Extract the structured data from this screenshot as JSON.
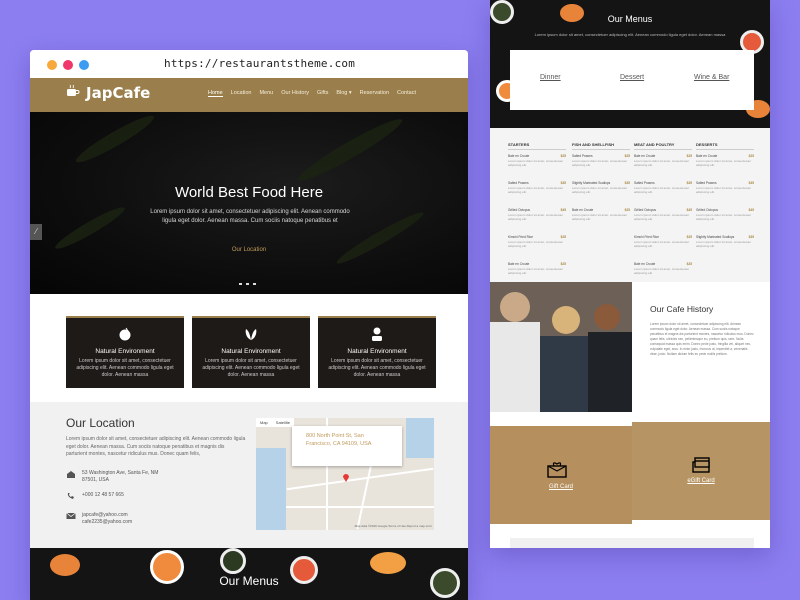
{
  "browser": {
    "url": "https://restaurantstheme.com"
  },
  "site": {
    "logo": "JapCafe",
    "nav": [
      "Home",
      "Location",
      "Menu",
      "Our History",
      "Gifts",
      "Blog ▾",
      "Reservation",
      "Contact"
    ]
  },
  "hero": {
    "title": "World Best Food Here",
    "subtitle": "Lorem ipsum dolor sit amet, consectetuer adipiscing elit. Aenean commodo ligula eget dolor. Aenean massa. Cum sociis natoque penatibus et",
    "link": "Our Location"
  },
  "features": [
    {
      "title": "Natural Environment",
      "text": "Lorem ipsum dolor sit amet, consectetuer adipiscing elit. Aenean commodo ligula eget dolor. Aenean massa"
    },
    {
      "title": "Natural Environment",
      "text": "Lorem ipsum dolor sit amet, consectetuer adipiscing elit. Aenean commodo ligula eget dolor. Aenean massa"
    },
    {
      "title": "Natural Environment",
      "text": "Lorem ipsum dolor sit amet, consectetuer adipiscing elit. Aenean commodo ligula eget dolor. Aenean massa"
    }
  ],
  "location": {
    "title": "Our Location",
    "desc": "Lorem ipsum dolor sit amet, consectetuer adipiscing elit. Aenean commodo ligula eget dolor. Aenean massa. Cum sociis natoque penatibus et magnis dis parturient montes, nascetur ridiculus mus. Donec quam felis,",
    "address": "53 Washington Ave, Santa Fe, NM 87501, USA",
    "phone": "+000 12 48 57 665",
    "email": "japcafe@yahoo.com\ncafe2235@yahoo.com",
    "map_tabs": [
      "Map",
      "Satellite"
    ],
    "map_popup": "800 North Point St, San Francisco, CA 94109, USA",
    "map_footer": "Map data ©2016 Google   Terms of Use   Report a map error"
  },
  "menus_strip": {
    "title": "Our Menus"
  },
  "right": {
    "menus_title": "Our Menus",
    "menus_sub": "Lorem ipsum dolor sit amet, consectetuer adipiscing elit. Aenean commodo ligula eget dolor. Aenean massa",
    "tabs": [
      "Dinner",
      "Dessert",
      "Wine & Bar"
    ],
    "columns": [
      {
        "head": "STARTERS",
        "items": [
          {
            "name": "Bale en Croute",
            "price": "$25"
          },
          {
            "name": "Salted Prawns",
            "price": "$35"
          },
          {
            "name": "Grilled Octopus",
            "price": "$45"
          },
          {
            "name": "Kimchi Fried Rice",
            "price": "$25"
          },
          {
            "name": "Bale en Croute",
            "price": "$25"
          }
        ]
      },
      {
        "head": "FISH AND SHELLFISH",
        "items": [
          {
            "name": "Salted Prawns",
            "price": "$25"
          },
          {
            "name": "Slightly Marinated Scallops",
            "price": "$35"
          },
          {
            "name": "Bale en Croute",
            "price": "$25"
          }
        ]
      },
      {
        "head": "MEAT AND POULTRY",
        "items": [
          {
            "name": "Bale en Croute",
            "price": "$25"
          },
          {
            "name": "Salted Prawns",
            "price": "$35"
          },
          {
            "name": "Grilled Octopus",
            "price": "$45"
          },
          {
            "name": "Kimchi Fried Rice",
            "price": "$25"
          },
          {
            "name": "Bale en Croute",
            "price": "$25"
          }
        ]
      },
      {
        "head": "DESSERTS",
        "items": [
          {
            "name": "Bale en Croute",
            "price": "$25"
          },
          {
            "name": "Salted Prawns",
            "price": "$35"
          },
          {
            "name": "Grilled Octopus",
            "price": "$45"
          },
          {
            "name": "Slightly Marinated Scallops",
            "price": "$35"
          }
        ]
      }
    ],
    "item_desc": "Lorem ipsum dolor sit amet, consectetuer adipiscing elit.",
    "history_title": "Our Cafe History",
    "history_text": "Lorem ipsum dolor sit amet, consectetuer adipiscing elit. Aenean commodo ligula eget dolor. Aenean massa. Cum sociis natoque penatibus et magnis dis parturient montes, nascetur ridiculus mus. Donec quam felis, ultricies nec, pellentesque eu, pretium quis, sem. Nulla consequat massa quis enim. Donec pede justo, fringilla vel, aliquet nec, vulputate eget, arcu. In enim justo, rhoncus ut, imperdiet a, venenatis vitae, justo. Nullam dictum felis eu pede mollis pretium.",
    "gift_card": "Gift Card",
    "egift_card": "eGift Card"
  },
  "colors": {
    "background": "#8c7ef0",
    "gold": "#9a7f4c",
    "accent": "#c19a5b",
    "dark": "#141414"
  }
}
